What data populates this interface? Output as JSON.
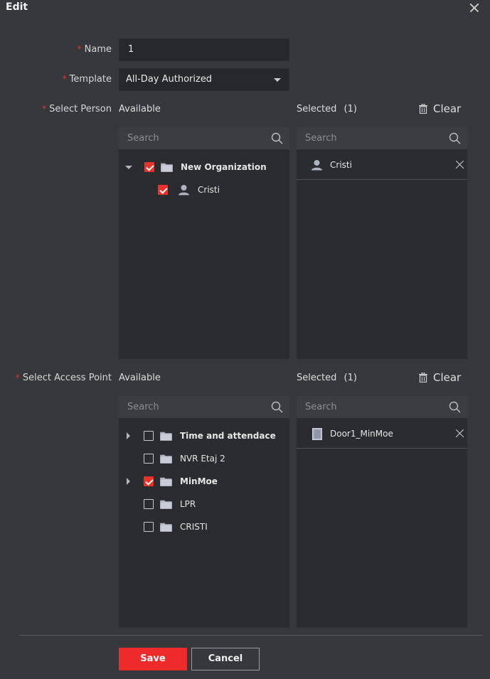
{
  "dialog": {
    "title": "Edit"
  },
  "form": {
    "name": {
      "label": "Name",
      "value": "1"
    },
    "template": {
      "label": "Template",
      "value": "All-Day Authorized"
    }
  },
  "person": {
    "label": "Select Person",
    "available_label": "Available",
    "selected_label": "Selected",
    "selected_count": "(1)",
    "clear_label": "Clear",
    "search_placeholder": "Search",
    "selected_search_placeholder": "Search",
    "tree": [
      {
        "label": "New Organization",
        "checked": true,
        "expanded": true
      },
      {
        "label": "Cristi",
        "checked": true
      }
    ],
    "selected_items": [
      {
        "label": "Cristi"
      }
    ]
  },
  "access_point": {
    "label": "Select Access Point",
    "available_label": "Available",
    "selected_label": "Selected",
    "selected_count": "(1)",
    "clear_label": "Clear",
    "search_placeholder": "Search",
    "selected_search_placeholder": "Search",
    "tree": [
      {
        "label": "Time and attendace",
        "checked": false
      },
      {
        "label": "NVR Etaj 2",
        "checked": false
      },
      {
        "label": "MinMoe",
        "checked": true
      },
      {
        "label": "LPR",
        "checked": false
      },
      {
        "label": "CRISTI",
        "checked": false
      }
    ],
    "selected_items": [
      {
        "label": "Door1_MinMoe"
      }
    ]
  },
  "footer": {
    "save_label": "Save",
    "cancel_label": "Cancel"
  },
  "colors": {
    "accent": "#ee2b2b",
    "background": "#36383c",
    "panel": "#2a2c2f"
  }
}
